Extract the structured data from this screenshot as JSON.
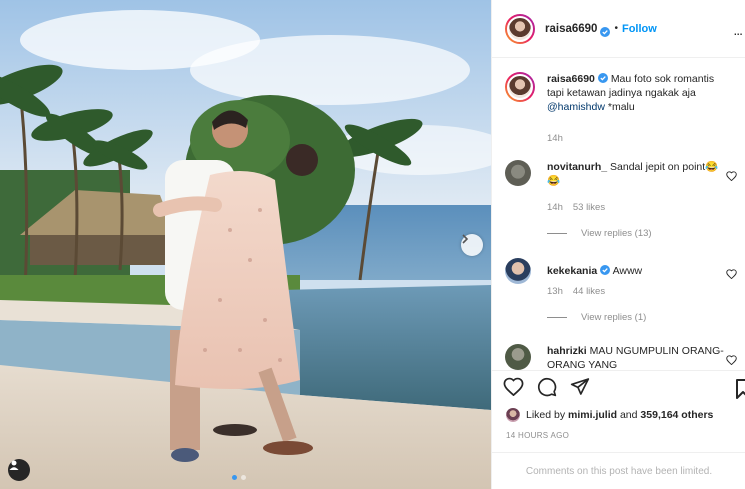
{
  "post": {
    "author": "raisa6690",
    "follow_label": "Follow",
    "follow_separator": "•",
    "more_label": "...",
    "caption": {
      "author": "raisa6690",
      "text_part1": "Mau foto sok romantis tapi ketawan jadinya ngakak aja ",
      "mention": "@hamishdw",
      "text_part2": " *malu",
      "time": "14h"
    },
    "comments": [
      {
        "user": "novitanurh_",
        "text": "Sandal jepit on point😂😂",
        "time": "14h",
        "likes": "53 likes",
        "replies": "View replies (13)"
      },
      {
        "user": "kekekania",
        "text": "Awww",
        "time": "13h",
        "likes": "44 likes",
        "replies": "View replies (1)"
      },
      {
        "user": "hahrizki",
        "text": "MAU NGUMPULIN ORANG-ORANG YANG"
      }
    ],
    "liked_by_prefix": "Liked by ",
    "liked_by_user": "mimi.julid",
    "liked_by_suffix": " and ",
    "liked_by_count": "359,164 others",
    "timestamp": "14 HOURS AGO",
    "comments_limited": "Comments on this post have been limited."
  },
  "colors": {
    "link_blue": "#0095f6",
    "verified_blue": "#3897f0",
    "muted": "#8e8e8e",
    "divider": "#efefef"
  },
  "icons": [
    "next-arrow-icon",
    "user-tag-icon",
    "verified-badge-icon",
    "heart-icon",
    "comment-icon",
    "share-icon",
    "bookmark-icon",
    "more-icon"
  ]
}
